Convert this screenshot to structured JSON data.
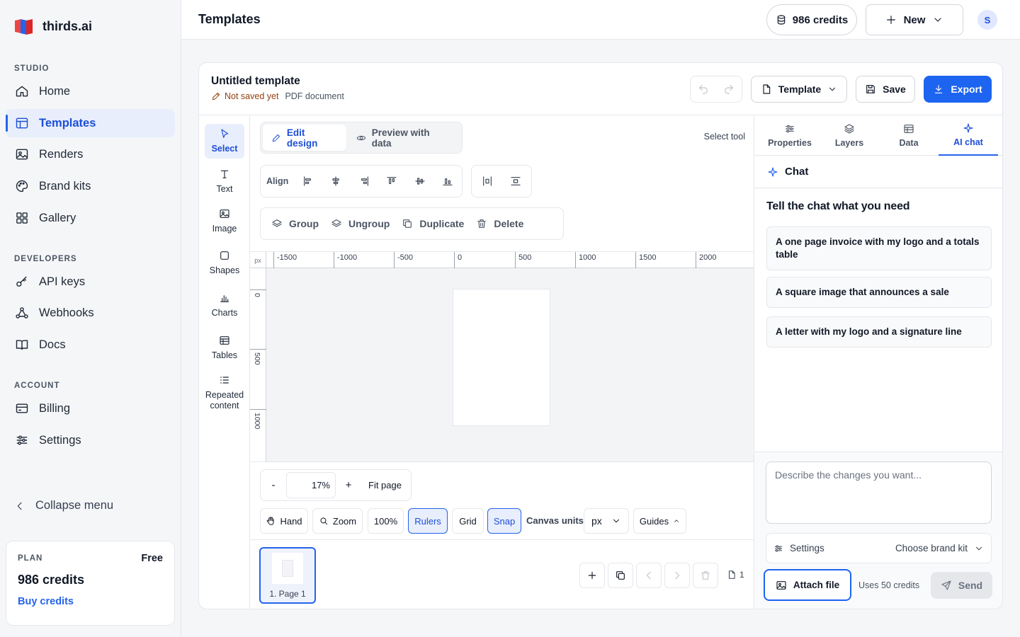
{
  "app": {
    "brand_name": "thirds.ai"
  },
  "sidebar": {
    "sections": {
      "studio": "STUDIO",
      "developers": "DEVELOPERS",
      "account": "ACCOUNT"
    },
    "items": [
      {
        "label": "Home",
        "icon": "home-icon"
      },
      {
        "label": "Templates",
        "icon": "template-icon",
        "active": true
      },
      {
        "label": "Renders",
        "icon": "image-icon"
      },
      {
        "label": "Brand kits",
        "icon": "palette-icon"
      },
      {
        "label": "Gallery",
        "icon": "grid-icon"
      },
      {
        "label": "API keys",
        "icon": "key-icon"
      },
      {
        "label": "Webhooks",
        "icon": "webhook-icon"
      },
      {
        "label": "Docs",
        "icon": "book-icon"
      },
      {
        "label": "Billing",
        "icon": "card-icon"
      },
      {
        "label": "Settings",
        "icon": "sliders-icon"
      }
    ],
    "collapse_label": "Collapse menu",
    "plan": {
      "label": "PLAN",
      "tier": "Free",
      "credits": "986 credits",
      "buy_label": "Buy credits"
    }
  },
  "topbar": {
    "title": "Templates",
    "credits": "986 credits",
    "new_label": "New",
    "avatar_initial": "S"
  },
  "editor": {
    "doc_title": "Untitled template",
    "save_status": "Not saved yet",
    "doc_type": "PDF document",
    "template_label": "Template",
    "save_label": "Save",
    "export_label": "Export",
    "tools": [
      {
        "label": "Select",
        "icon": "cursor-icon",
        "active": true
      },
      {
        "label": "Text",
        "icon": "text-icon"
      },
      {
        "label": "Image",
        "icon": "image-icon"
      },
      {
        "label": "Shapes",
        "icon": "square-icon"
      },
      {
        "label": "Charts",
        "icon": "bar-chart-icon"
      },
      {
        "label": "Tables",
        "icon": "table-icon"
      },
      {
        "label": "Repeated content",
        "icon": "list-icon"
      }
    ],
    "modes": {
      "edit": "Edit design",
      "preview": "Preview with data"
    },
    "current_tool": "Select tool",
    "align_label": "Align",
    "actions": {
      "group": "Group",
      "ungroup": "Ungroup",
      "duplicate": "Duplicate",
      "delete": "Delete"
    },
    "ruler": {
      "unit": "px",
      "x_ticks": [
        "-1500",
        "-1000",
        "-500",
        "0",
        "500",
        "1000",
        "1500",
        "2000"
      ],
      "y_ticks": [
        "0",
        "500",
        "1000"
      ]
    },
    "zoom": {
      "minus": "-",
      "value": "17%",
      "plus": "+",
      "fit_label": "Fit page"
    },
    "view_controls": {
      "hand": "Hand",
      "zoom": "Zoom",
      "hundred": "100%",
      "rulers": "Rulers",
      "grid": "Grid",
      "snap": "Snap",
      "canvas_units_label": "Canvas units",
      "units_value": "px",
      "guides": "Guides"
    },
    "pages": {
      "thumb_label": "1. Page 1",
      "count": "1"
    }
  },
  "panel": {
    "tabs": [
      {
        "label": "Properties",
        "icon": "sliders-icon"
      },
      {
        "label": "Layers",
        "icon": "layers-icon"
      },
      {
        "label": "Data",
        "icon": "table-icon"
      },
      {
        "label": "AI chat",
        "icon": "sparkle-icon",
        "active": true
      }
    ],
    "chat_title": "Chat",
    "prompt": "Tell the chat what you need",
    "suggestions": [
      "A one page invoice with my logo and a totals table",
      "A square image that announces a sale",
      "A letter with my logo and a signature line"
    ],
    "input_placeholder": "Describe the changes you want...",
    "settings_label": "Settings",
    "brand_kit_label": "Choose brand kit",
    "attach_label": "Attach file",
    "uses_label": "Uses 50 credits",
    "send_label": "Send"
  }
}
